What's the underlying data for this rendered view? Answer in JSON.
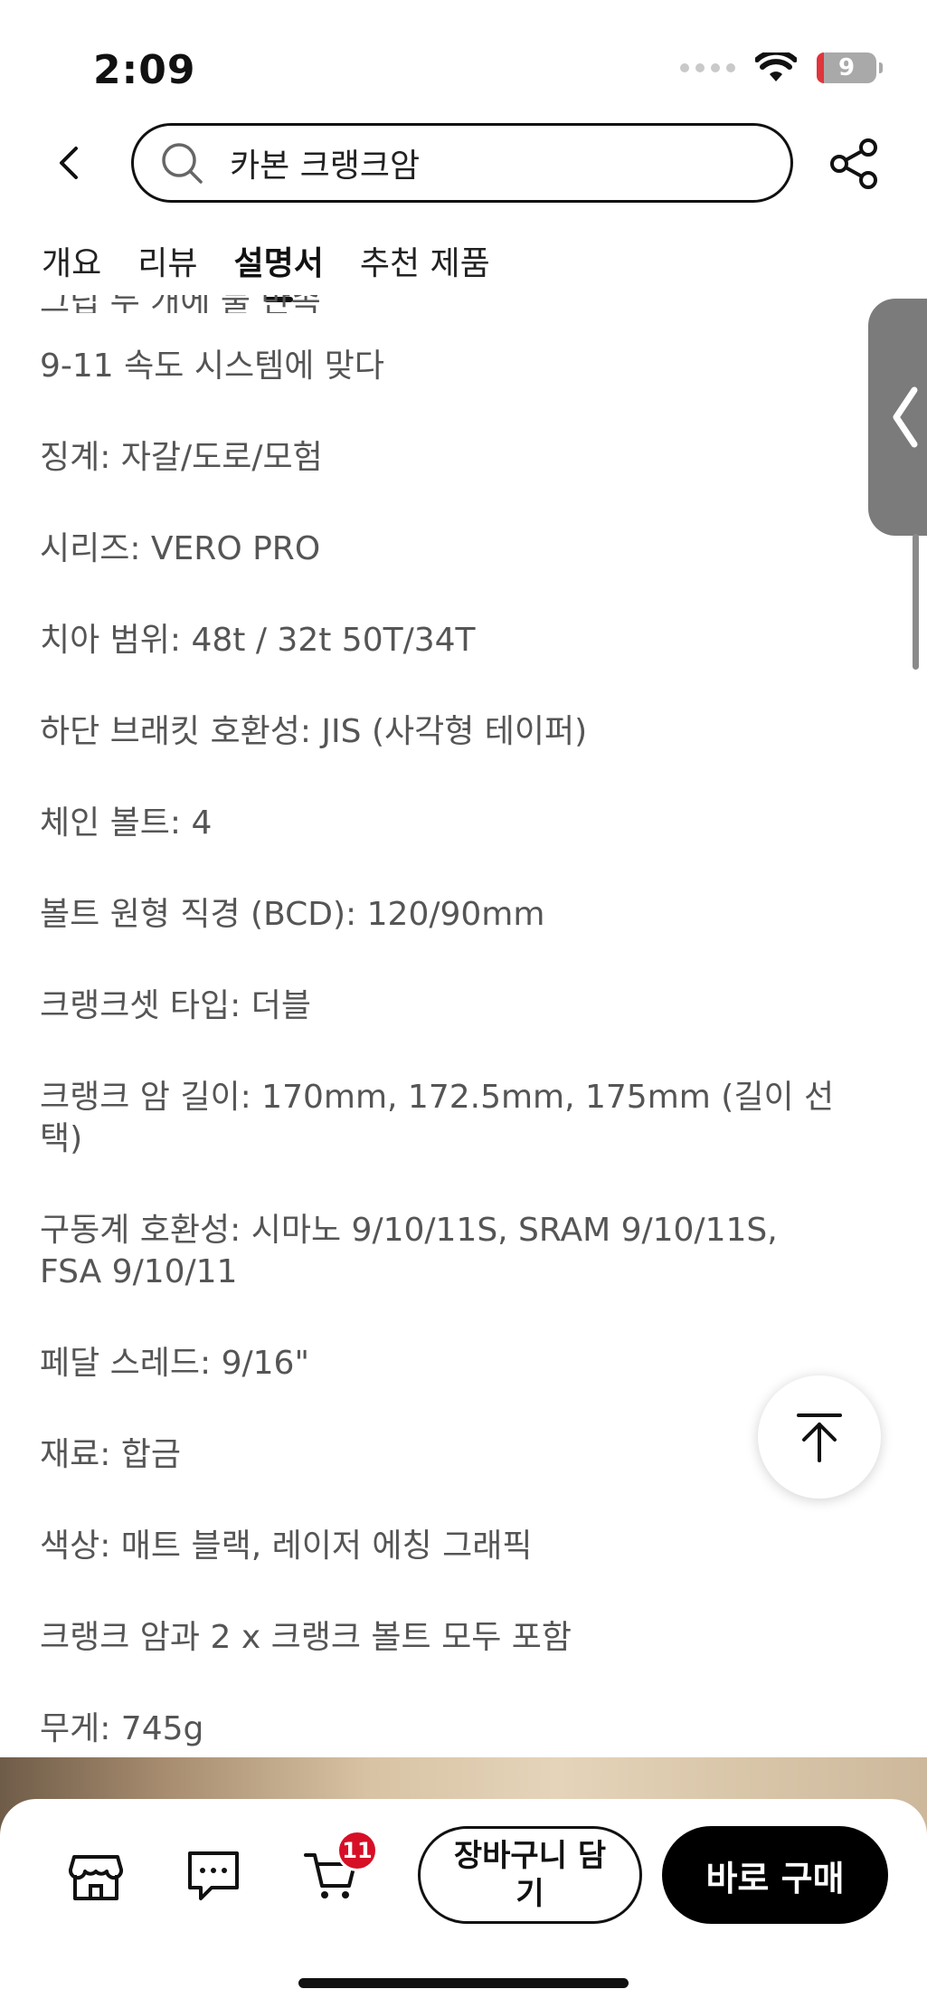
{
  "status_bar": {
    "time": "2:09",
    "battery": "9"
  },
  "header": {
    "search_text": "카본 크랭크암"
  },
  "tabs": [
    {
      "label": "개요"
    },
    {
      "label": "리뷰"
    },
    {
      "label": "설명서",
      "active": true
    },
    {
      "label": "추천 제품"
    }
  ],
  "specs": {
    "partial_line": "그립 두 개에 둘 만족",
    "items": [
      "9-11 속도 시스템에 맞다",
      "징계: 자갈/도로/모험",
      "시리즈: VERO PRO",
      "치아 범위: 48t / 32t 50T/34T",
      "하단 브래킷 호환성: JIS (사각형 테이퍼)",
      "체인 볼트: 4",
      "볼트 원형 직경 (BCD): 120/90mm",
      "크랭크셋 타입: 더블",
      "크랭크 암 길이: 170mm, 172.5mm, 175mm (길이 선택)",
      "구동계 호환성: 시마노 9/10/11S, SRAM 9/10/11S, FSA 9/10/11",
      "페달 스레드: 9/16\"",
      "재료: 합금",
      "색상: 매트 블랙, 레이저 에칭 그래픽",
      "크랭크 암과 2 x 크랭크 볼트 모두 포함",
      "무게: 745g"
    ]
  },
  "bottom_bar": {
    "cart_badge": "11",
    "add_to_cart": "장바구니 담기",
    "buy_now": "바로 구매"
  },
  "icons": [
    "back-icon",
    "search-icon",
    "share-icon",
    "chevron-left-icon",
    "scroll-to-top-icon",
    "store-icon",
    "chat-icon",
    "cart-icon"
  ]
}
